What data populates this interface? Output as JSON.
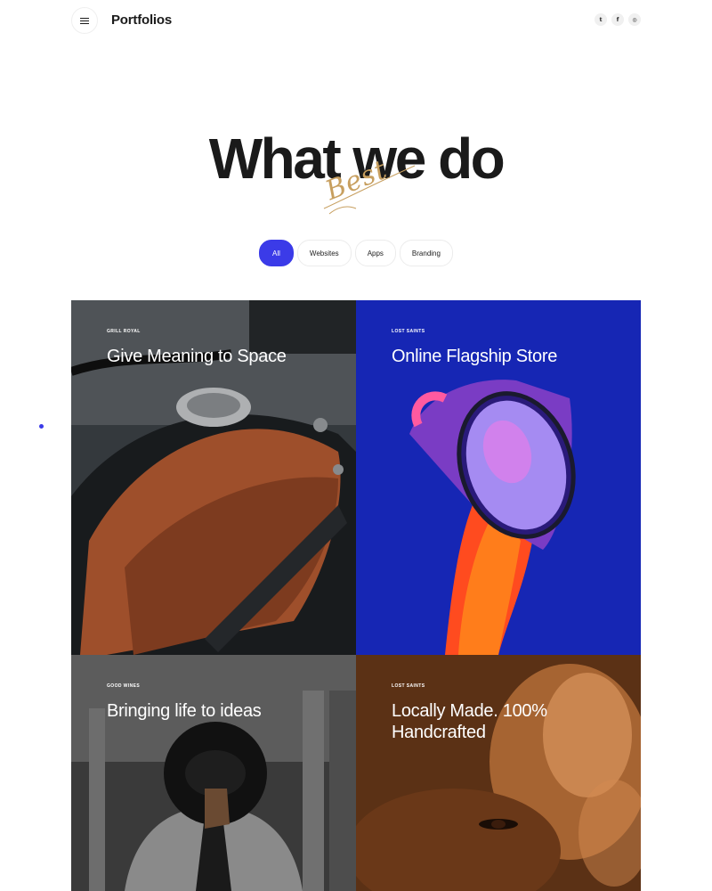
{
  "header": {
    "brand": "Portfolios",
    "socials": [
      {
        "icon": "twitter-icon",
        "glyph": "t"
      },
      {
        "icon": "facebook-icon",
        "glyph": "f"
      },
      {
        "icon": "dribbble-icon",
        "glyph": "◎"
      }
    ]
  },
  "hero": {
    "title": "What we do",
    "script": "Best"
  },
  "filters": [
    "All",
    "Websites",
    "Apps",
    "Branding"
  ],
  "active_filter": "All",
  "colors": {
    "accent": "#3b3be8",
    "script": "#c79f5f"
  },
  "projects": [
    {
      "client": "GRILL ROYAL",
      "title": "Give Meaning to Space",
      "image": "motorcycle-tank"
    },
    {
      "client": "LOST SAINTS",
      "title": "Online Flagship Store",
      "image": "hand-with-lens"
    },
    {
      "client": "GOOD WINES",
      "title": "Bringing life to ideas",
      "image": "man-with-hat"
    },
    {
      "client": "LOST SAINTS",
      "title": "Locally Made. 100% Handcrafted",
      "image": "face-closeup"
    }
  ]
}
